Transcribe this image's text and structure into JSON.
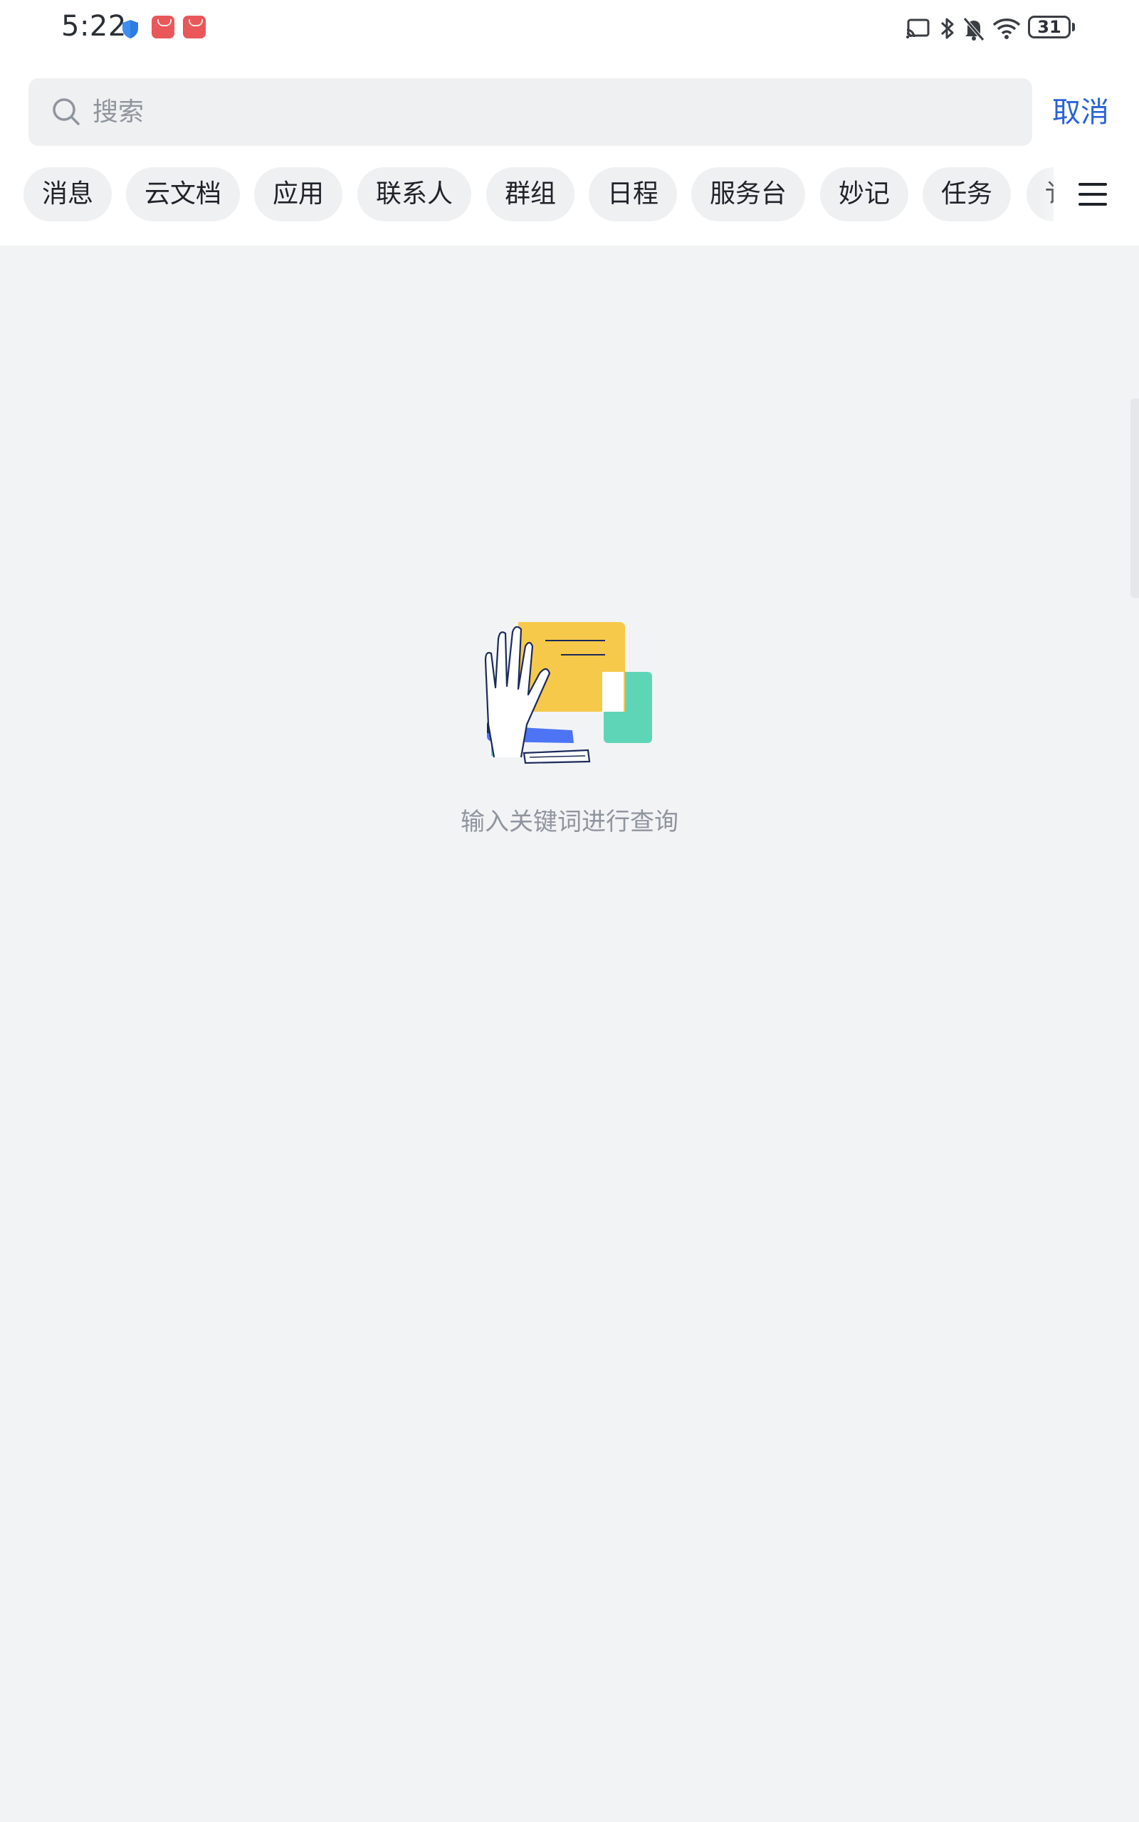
{
  "status_bar": {
    "time": "5:22",
    "battery_level": "31",
    "icons": [
      "shield-icon",
      "app-store-icon",
      "app-store-icon",
      "screen-cast-icon",
      "bluetooth-icon",
      "bell-muted-icon",
      "wifi-icon",
      "battery-icon"
    ]
  },
  "search": {
    "placeholder": "搜索",
    "value": "",
    "cancel_label": "取消"
  },
  "tabs": [
    {
      "label": "消息"
    },
    {
      "label": "云文档"
    },
    {
      "label": "应用"
    },
    {
      "label": "联系人"
    },
    {
      "label": "群组"
    },
    {
      "label": "日程"
    },
    {
      "label": "服务台"
    },
    {
      "label": "妙记"
    },
    {
      "label": "任务"
    },
    {
      "label": "讠"
    }
  ],
  "empty_state": {
    "hint": "输入关键词进行查询",
    "illustration": "hand-and-documents-illustration"
  },
  "colors": {
    "accent": "#2a63d6",
    "background": "#f2f3f5",
    "chip_background": "#eff0f1",
    "hint_text": "#8f959e",
    "illustration_yellow": "#f6c94a",
    "illustration_teal": "#5fd5b8",
    "illustration_blue": "#4c74f5"
  }
}
